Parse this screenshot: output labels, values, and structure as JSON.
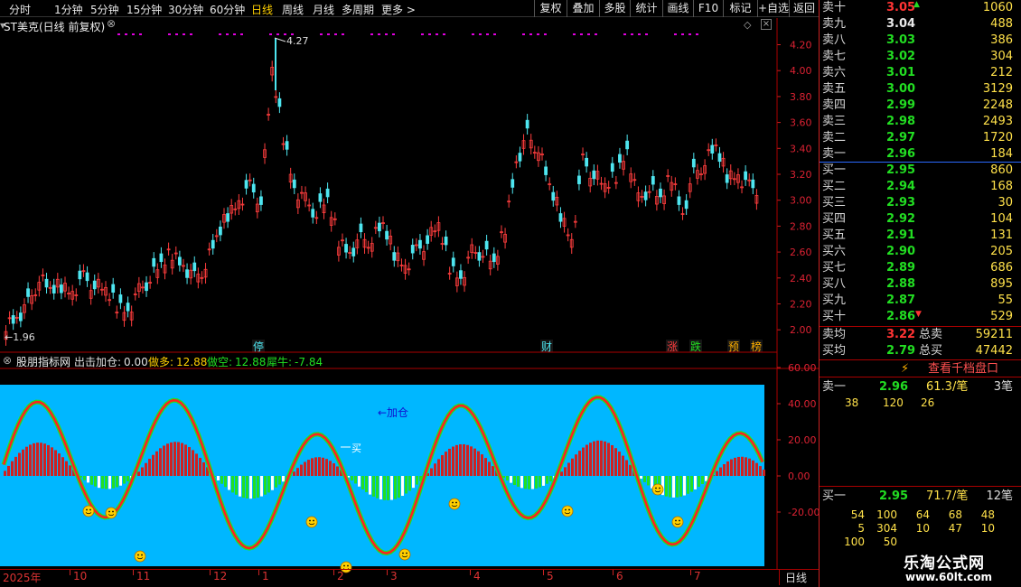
{
  "toolbar": {
    "timeframes": [
      "分时",
      "1分钟",
      "5分钟",
      "15分钟",
      "30分钟",
      "60分钟",
      "日线",
      "周线",
      "月线",
      "多周期",
      "更多 >"
    ],
    "active_timeframe": "日线",
    "buttons": [
      "复权",
      "叠加",
      "多股",
      "统计",
      "画线",
      "F10",
      "标记",
      "+自选",
      "返回"
    ]
  },
  "main_chart": {
    "title": "ST美克(日线 前复权)",
    "price_axis": [
      "4.20",
      "4.00",
      "3.80",
      "3.60",
      "3.40",
      "3.20",
      "3.00",
      "2.80",
      "2.60",
      "2.40",
      "2.20",
      "2.00"
    ],
    "high_label": "4.27",
    "low_label": "←1.96",
    "event_markers": [
      "停",
      "财",
      "涨",
      "跌",
      "预",
      "榜"
    ]
  },
  "indicator": {
    "name": "股朋指标网",
    "fields": [
      {
        "label": "出击加仓:",
        "value": "0.00",
        "color": "#e0e0e0"
      },
      {
        "label": "做多:",
        "value": "12.88",
        "color": "#ffd000"
      },
      {
        "label": "做空:",
        "value": "12.88",
        "color": "#22e022"
      },
      {
        "label": "犀牛:",
        "value": "-7.84",
        "color": "#22e022"
      }
    ],
    "axis": [
      "60.00",
      "40.00",
      "20.00",
      "0.00",
      "-20.00"
    ],
    "annotations": {
      "add_position": "←加仓",
      "buy": "买"
    }
  },
  "x_axis": {
    "labels": [
      "2025年",
      "10",
      "11",
      "12",
      "1",
      "2",
      "3",
      "4",
      "5",
      "6",
      "7"
    ],
    "period": "日线"
  },
  "order_book": {
    "asks": [
      {
        "label": "卖十",
        "price": "3.05",
        "vol": "1060",
        "color": "#ff3333"
      },
      {
        "label": "卖九",
        "price": "3.04",
        "vol": "488",
        "color": "#e8e8e8"
      },
      {
        "label": "卖八",
        "price": "3.03",
        "vol": "386",
        "color": "#22dd22"
      },
      {
        "label": "卖七",
        "price": "3.02",
        "vol": "304",
        "color": "#22dd22"
      },
      {
        "label": "卖六",
        "price": "3.01",
        "vol": "212",
        "color": "#22dd22"
      },
      {
        "label": "卖五",
        "price": "3.00",
        "vol": "3129",
        "color": "#22dd22"
      },
      {
        "label": "卖四",
        "price": "2.99",
        "vol": "2248",
        "color": "#22dd22"
      },
      {
        "label": "卖三",
        "price": "2.98",
        "vol": "2493",
        "color": "#22dd22"
      },
      {
        "label": "卖二",
        "price": "2.97",
        "vol": "1720",
        "color": "#22dd22"
      },
      {
        "label": "卖一",
        "price": "2.96",
        "vol": "184",
        "color": "#22dd22"
      }
    ],
    "bids": [
      {
        "label": "买一",
        "price": "2.95",
        "vol": "860",
        "color": "#22dd22"
      },
      {
        "label": "买二",
        "price": "2.94",
        "vol": "168",
        "color": "#22dd22"
      },
      {
        "label": "买三",
        "price": "2.93",
        "vol": "30",
        "color": "#22dd22"
      },
      {
        "label": "买四",
        "price": "2.92",
        "vol": "104",
        "color": "#22dd22"
      },
      {
        "label": "买五",
        "price": "2.91",
        "vol": "131",
        "color": "#22dd22"
      },
      {
        "label": "买六",
        "price": "2.90",
        "vol": "205",
        "color": "#22dd22"
      },
      {
        "label": "买七",
        "price": "2.89",
        "vol": "686",
        "color": "#22dd22"
      },
      {
        "label": "买八",
        "price": "2.88",
        "vol": "895",
        "color": "#22dd22"
      },
      {
        "label": "买九",
        "price": "2.87",
        "vol": "55",
        "color": "#22dd22"
      },
      {
        "label": "买十",
        "price": "2.86",
        "vol": "529",
        "color": "#22dd22"
      }
    ],
    "summary": [
      {
        "label": "卖均",
        "price": "3.22",
        "price_color": "#ff3333",
        "tlabel": "总卖",
        "total": "59211"
      },
      {
        "label": "买均",
        "price": "2.79",
        "price_color": "#22dd22",
        "tlabel": "总买",
        "total": "47442"
      }
    ],
    "kilo_button": "查看千档盘口",
    "sell_queue": {
      "label": "卖一",
      "price": "2.96",
      "avg": "61.3/笔",
      "count": "3笔",
      "orders": [
        "38",
        "120",
        "26"
      ]
    },
    "buy_queue": {
      "label": "买一",
      "price": "2.95",
      "avg": "71.7/笔",
      "count": "12笔",
      "orders": [
        [
          "54",
          "100",
          "64",
          "68",
          "48"
        ],
        [
          "5",
          "304",
          "10",
          "47",
          "10"
        ],
        [
          "100",
          "50"
        ]
      ]
    }
  },
  "watermark": {
    "name": "乐淘公式网",
    "url": "www.60lt.com"
  },
  "colors": {
    "up": "#ff3d3d",
    "down": "#4ee6f0",
    "indicator_bg": "#00b7ff",
    "pink": "#e000e0"
  }
}
